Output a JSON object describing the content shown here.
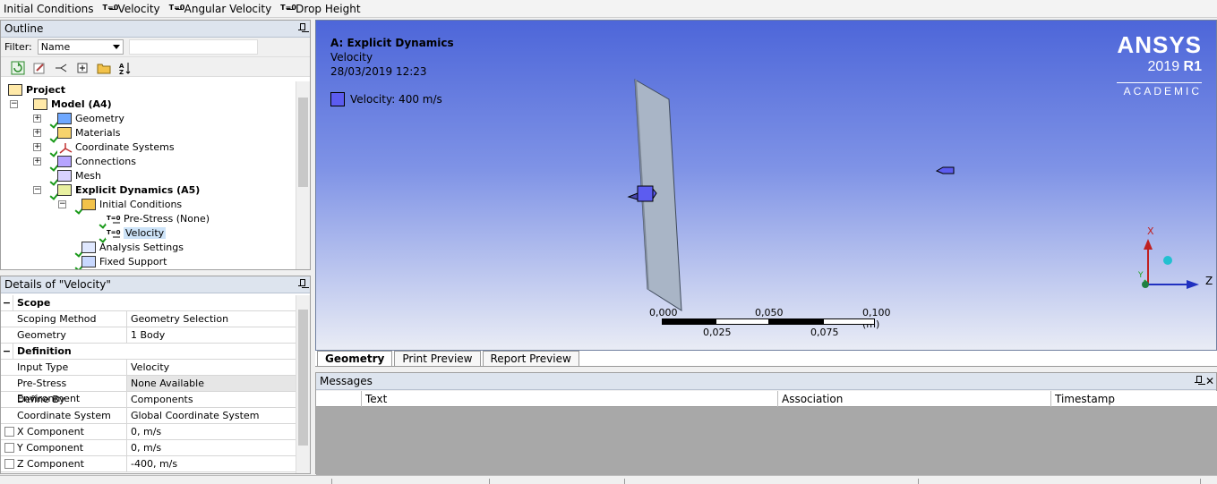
{
  "toolbar": {
    "items": [
      {
        "label": "Initial Conditions",
        "icon": ""
      },
      {
        "label": "Velocity",
        "icon": "velocity-icon"
      },
      {
        "label": "Angular Velocity",
        "icon": "angular-velocity-icon"
      },
      {
        "label": "Drop Height",
        "icon": "drop-height-icon"
      }
    ]
  },
  "outline": {
    "title": "Outline",
    "filter_label": "Filter:",
    "filter_value": "Name",
    "tree": [
      {
        "label": "Project",
        "bold": true
      },
      {
        "label": "Model (A4)",
        "bold": true
      },
      {
        "label": "Geometry"
      },
      {
        "label": "Materials"
      },
      {
        "label": "Coordinate Systems"
      },
      {
        "label": "Connections"
      },
      {
        "label": "Mesh"
      },
      {
        "label": "Explicit Dynamics (A5)",
        "bold": true
      },
      {
        "label": "Initial Conditions"
      },
      {
        "label": "Pre-Stress (None)"
      },
      {
        "label": "Velocity"
      },
      {
        "label": "Analysis Settings"
      },
      {
        "label": "Fixed Support"
      }
    ]
  },
  "details": {
    "title": "Details of \"Velocity\"",
    "sections": [
      {
        "name": "Scope",
        "rows": [
          {
            "key": "Scoping Method",
            "value": "Geometry Selection"
          },
          {
            "key": "Geometry",
            "value": "1 Body"
          }
        ]
      },
      {
        "name": "Definition",
        "rows": [
          {
            "key": "Input Type",
            "value": "Velocity"
          },
          {
            "key": "Pre-Stress Environment",
            "value": "None Available"
          },
          {
            "key": "Define By",
            "value": "Components"
          },
          {
            "key": "Coordinate System",
            "value": "Global Coordinate System"
          },
          {
            "key": "X Component",
            "value": "0, m/s"
          },
          {
            "key": "Y Component",
            "value": "0, m/s"
          },
          {
            "key": "Z Component",
            "value": "-400, m/s"
          }
        ]
      }
    ]
  },
  "viewport": {
    "analysis": "A: Explicit Dynamics",
    "object": "Velocity",
    "timestamp": "28/03/2019 12:23",
    "legend": "Velocity: 400 m/s",
    "legend_color": "#5c5cf0",
    "logo": {
      "brand": "ANSYS",
      "version": "2019",
      "release": "R1",
      "edition": "ACADEMIC"
    },
    "scale": {
      "top": [
        "0,000",
        "0,050",
        "0,100 (m)"
      ],
      "bottom": [
        "0,025",
        "0,075"
      ]
    },
    "axes": {
      "x": "X",
      "y": "Y",
      "z": "Z"
    }
  },
  "view_tabs": [
    "Geometry",
    "Print Preview",
    "Report Preview"
  ],
  "messages": {
    "title": "Messages",
    "columns": [
      "Text",
      "Association",
      "Timestamp"
    ]
  }
}
